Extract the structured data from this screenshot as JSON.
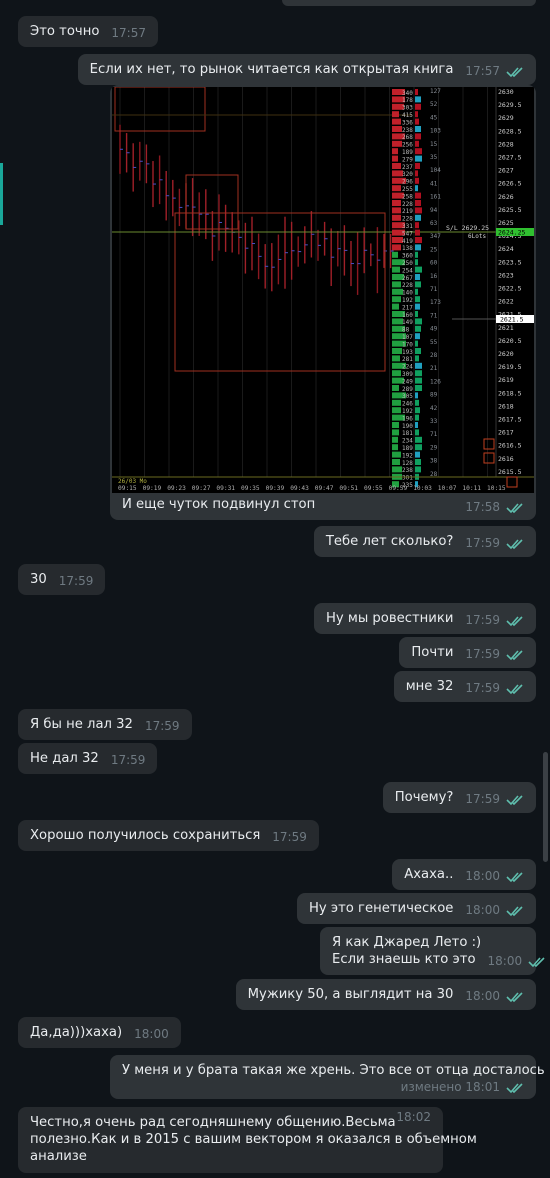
{
  "messages": {
    "m1": {
      "text": "Это точно",
      "time": "17:57"
    },
    "m2": {
      "text": "Если их нет, то рынок читается как открытая книга",
      "time": "17:57"
    },
    "m3": {
      "caption": "И еще чуток подвинул стоп",
      "time": "17:58"
    },
    "m4": {
      "text": "Тебе лет сколько?",
      "time": "17:59"
    },
    "m5": {
      "text": "30",
      "time": "17:59"
    },
    "m6": {
      "text": "Ну мы ровестники",
      "time": "17:59"
    },
    "m7": {
      "text": "Почти",
      "time": "17:59"
    },
    "m8": {
      "text": "мне 32",
      "time": "17:59"
    },
    "m9": {
      "text": "Я бы не лал 32",
      "time": "17:59"
    },
    "m10": {
      "text": "Не дал 32",
      "time": "17:59"
    },
    "m11": {
      "text": "Почему?",
      "time": "17:59"
    },
    "m12": {
      "text": "Хорошо получилось сохраниться",
      "time": "17:59"
    },
    "m13": {
      "text": "Ахаха..",
      "time": "18:00"
    },
    "m14": {
      "text": "Ну это генетическое",
      "time": "18:00"
    },
    "m15": {
      "line1": "Я как Джаред Лето :)",
      "line2": "Если знаешь кто это",
      "time": "18:00"
    },
    "m16": {
      "text": "Мужику 50, а выглядит на 30",
      "time": "18:00"
    },
    "m17": {
      "text": "Да,да)))хаха)",
      "time": "18:00"
    },
    "m18": {
      "text": "У меня и у брата такая же хрень. Это все от отца досталось",
      "time": "изменено 18:01"
    },
    "m19": {
      "line1": "Честно,я очень рад сегодняшнему общению.Весьма",
      "line2": "полезно.Как и в 2015 с вашим вектором я оказался в объемном",
      "line3": "анализе",
      "time": "18:02"
    }
  },
  "chart_image": {
    "price_labels": [
      "2630",
      "2629.5",
      "2629",
      "2628.5",
      "2628",
      "2627.5",
      "2627",
      "2626.5",
      "2626",
      "2625.5",
      "2625",
      "2624.5",
      "2624",
      "2623.5",
      "2623",
      "2622.5",
      "2622",
      "2621.5",
      "2621",
      "2620.5",
      "2620",
      "2619.5",
      "2619",
      "2618.5",
      "2618",
      "2617.5",
      "2617",
      "2616.5",
      "2616",
      "2615.5"
    ],
    "current_price": "2624.25",
    "stop_label": "S/L 2629.25",
    "lots_label": "6Lots",
    "marker_price": "2621.5",
    "time_labels": [
      "09:15",
      "09:19",
      "09:23",
      "09:27",
      "09:31",
      "09:35",
      "09:39",
      "09:43",
      "09:47",
      "09:51",
      "09:55",
      "09:59",
      "10:03",
      "10:07",
      "10:11",
      "10:15"
    ],
    "date_label": "26/03 Mo",
    "volumes": [
      "340",
      "178",
      "303",
      "415",
      "336",
      "238",
      "268",
      "256",
      "189",
      "279",
      "237",
      "320",
      "296",
      "255",
      "258",
      "228",
      "219",
      "228",
      "331",
      "547",
      "419",
      "138",
      "360",
      "250",
      "254",
      "267",
      "228",
      "140",
      "192",
      "217",
      "160",
      "149",
      "88",
      "107",
      "170",
      "193",
      "281",
      "224",
      "309",
      "249",
      "289",
      "305",
      "246",
      "192",
      "196",
      "190",
      "181",
      "234",
      "189",
      "192",
      "128",
      "238",
      "301",
      "235"
    ],
    "deltas": [
      "127",
      "52",
      "45",
      "103",
      "15",
      "35",
      "104",
      "41",
      "161",
      "94",
      "63",
      "347",
      "25",
      "60",
      "16",
      "71",
      "173",
      "71",
      "49",
      "55",
      "28",
      "21",
      "126",
      "89",
      "42",
      "33",
      "71",
      "29",
      "38",
      "28"
    ]
  },
  "colors": {
    "accent": "#1aa89a",
    "check": "#5fbfae",
    "bubble": "#2f3438",
    "background": "#0f1419"
  }
}
